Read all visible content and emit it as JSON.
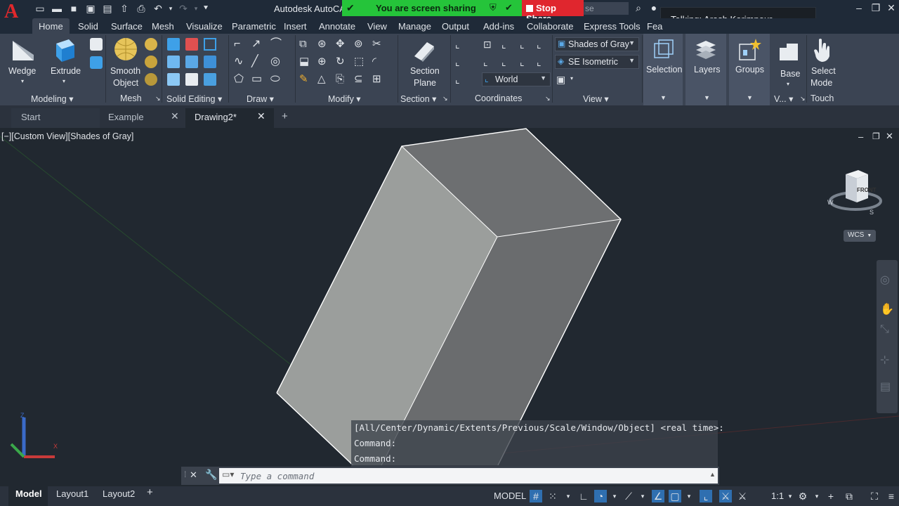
{
  "app": {
    "logo_letter": "A",
    "title": "Autodesk AutoCA",
    "search_fragment": "se"
  },
  "screen_share": {
    "status": "You are screen sharing",
    "stop_label": "Stop Share",
    "talking": "Talking: Arash Karimpour"
  },
  "menu_tabs": [
    "Home",
    "Solid",
    "Surface",
    "Mesh",
    "Visualize",
    "Parametric",
    "Insert",
    "Annotate",
    "View",
    "Manage",
    "Output",
    "Add-ins",
    "Collaborate",
    "Express Tools",
    "Fea"
  ],
  "ribbon": {
    "wedge": "Wedge",
    "extrude": "Extrude",
    "smooth_object_1": "Smooth",
    "smooth_object_2": "Object",
    "section_plane_1": "Section",
    "section_plane_2": "Plane",
    "visual_style": "Shades of Gray",
    "view_preset": "SE Isometric",
    "ucs": "World",
    "selection": "Selection",
    "layers": "Layers",
    "groups": "Groups",
    "base": "Base",
    "select_mode_1": "Select",
    "select_mode_2": "Mode",
    "panels": {
      "modeling": "Modeling",
      "mesh": "Mesh",
      "solid_editing": "Solid Editing",
      "draw": "Draw",
      "modify": "Modify",
      "section": "Section",
      "coordinates": "Coordinates",
      "view": "View",
      "v": "V...",
      "touch": "Touch"
    }
  },
  "file_tabs": [
    "Start",
    "Example",
    "Drawing2*"
  ],
  "viewport": {
    "label": "[−][Custom View][Shades of Gray]",
    "viewcube_face": "FRONT",
    "wcs": "WCS",
    "compass_w": "W",
    "compass_s": "S",
    "axis_z": "Z",
    "axis_x": "X"
  },
  "command": {
    "history": [
      "[All/Center/Dynamic/Extents/Previous/Scale/Window/Object] <real time>:",
      "Command:",
      "Command:"
    ],
    "placeholder": "Type a command"
  },
  "layout_tabs": [
    "Model",
    "Layout1",
    "Layout2"
  ],
  "status": {
    "model": "MODEL",
    "scale": "1:1"
  },
  "colors": {
    "accent_blue": "#2f6fb0",
    "share_green": "#25c43a",
    "stop_red": "#e0262e",
    "logo_red": "#e0282c"
  }
}
